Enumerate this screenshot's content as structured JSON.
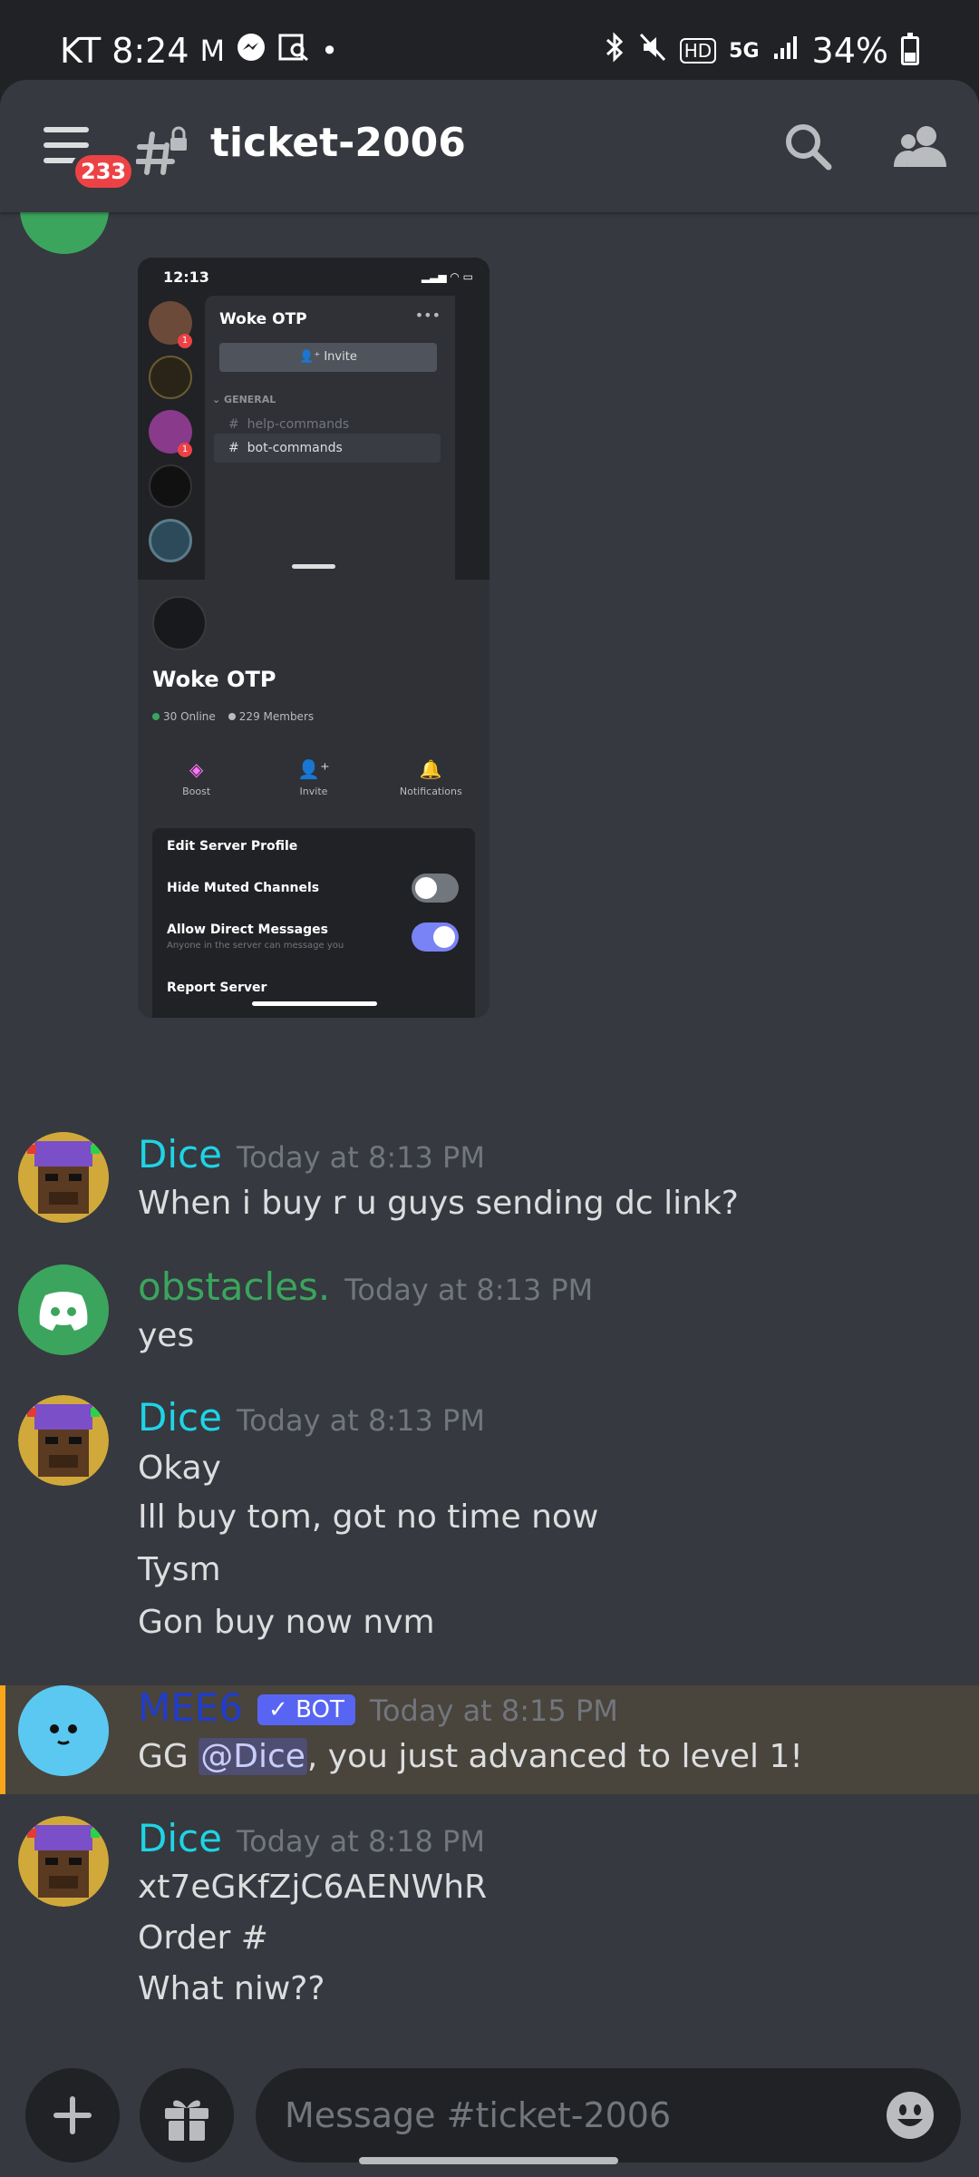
{
  "status_bar": {
    "carrier": "KT",
    "time": "8:24",
    "battery": "34%",
    "network": "5G"
  },
  "header": {
    "channel_name": "ticket-2006",
    "notification_count": "233"
  },
  "embedded_image": {
    "time": "12:13",
    "server_name": "Woke OTP",
    "invite_label": "Invite",
    "category": "GENERAL",
    "channels": [
      "help-commands",
      "bot-commands"
    ],
    "online": "30 Online",
    "members": "229 Members",
    "actions": [
      "Boost",
      "Invite",
      "Notifications"
    ],
    "menu": {
      "edit_profile": "Edit Server Profile",
      "hide_muted": "Hide Muted Channels",
      "allow_dm": "Allow Direct Messages",
      "allow_dm_sub": "Anyone in the server can message you",
      "report": "Report Server"
    },
    "hide_muted_on": false,
    "allow_dm_on": true
  },
  "messages": [
    {
      "author": "Dice",
      "timestamp": "Today at 8:13 PM",
      "lines": [
        "When i buy r u guys sending dc link?"
      ]
    },
    {
      "author": "obstacles.",
      "timestamp": "Today at 8:13 PM",
      "lines": [
        "yes"
      ]
    },
    {
      "author": "Dice",
      "timestamp": "Today at 8:13 PM",
      "lines": [
        "Okay",
        "Ill buy tom, got no time now",
        "Tysm",
        "Gon buy now nvm"
      ]
    },
    {
      "author": "MEE6",
      "bot_tag": "BOT",
      "timestamp": "Today at 8:15 PM",
      "text_prefix": "GG ",
      "mention": "@Dice",
      "text_suffix": ", you just advanced to level 1!"
    },
    {
      "author": "Dice",
      "timestamp": "Today at 8:18 PM",
      "lines": [
        "xt7eGKfZjC6AENWhR",
        "Order #",
        "What niw??"
      ]
    }
  ],
  "composer": {
    "placeholder": "Message #ticket-2006"
  },
  "colors": {
    "dice": "#1ed4e6",
    "obstacles": "#3ba55d",
    "mee6": "#1f3ccc",
    "bot_tag": "#5865f2",
    "mention_highlight": "#faa61a"
  }
}
